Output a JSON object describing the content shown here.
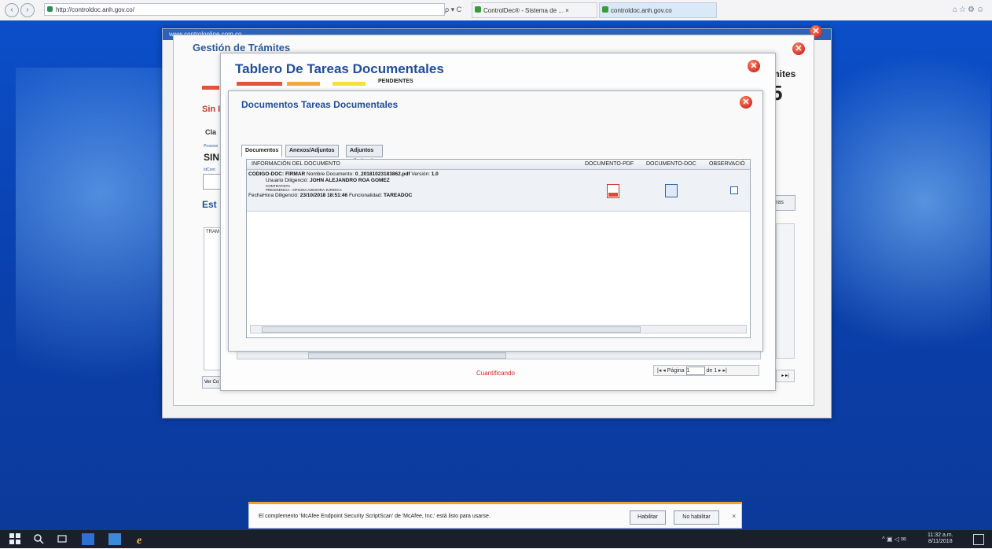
{
  "browser": {
    "address": "http://controldoc.anh.gov.co/",
    "address_controls": "ρ ▾ C",
    "tabs": [
      {
        "label": "ControlDec® - Sistema de ... ×"
      },
      {
        "label": "controldoc.anh.gov.co"
      }
    ],
    "nav_back": "‹",
    "nav_forward": "›",
    "toolbar_icons": "⌂☆⚙☺"
  },
  "portal": {
    "header": "www.controlonline.com.co"
  },
  "gestion": {
    "title": "Gestión de Trámites",
    "right_label": "mites",
    "right_number": "5",
    "left_fragments": [
      "Sin I",
      "Cla",
      "Proceso",
      "SIN",
      "IdCont",
      "Est",
      "TRAM",
      "Ver Co"
    ],
    "otros_button": "tras"
  },
  "tablero": {
    "title": "Tablero De Tareas Documentales",
    "pending_label": "PENDIENTES",
    "bar_colors": [
      "#e8523a",
      "#f0a93a",
      "#f2e23a"
    ],
    "status": "Cuantificando",
    "pager": {
      "first": "|◂",
      "prev": "◂",
      "page_label": "Página",
      "page_value": "1",
      "of_label": "de 1",
      "next": "▸",
      "last": "▸|"
    }
  },
  "documentos": {
    "title": "Documentos Tareas Documentales",
    "tabs": [
      "Documentos",
      "Anexos/Adjuntos",
      "Adjuntos Eliminados"
    ],
    "columns": [
      "INFORMACIÓN DEL DOCUMENTO",
      "DOCUMENTO-PDF",
      "DOCUMENTO-DOC",
      "OBSERVACIÓ"
    ],
    "row": {
      "codigo_label": "CODIGO-DOC:",
      "codigo_value": "FIRMAR",
      "nombre_label": "Nombre Documento:",
      "nombre_value": "0_20181023183862.pdf",
      "version_label": "Versión:",
      "version_value": "1.0",
      "usuario_label": "Usuario Diligenció:",
      "usuario_value": "JOHN ALEJANDRO ROA GOMEZ",
      "cargo": "CONTRATISTA",
      "dependencia": "PRESIDENCIA - OFICINA ASESORA JURIDICA",
      "fecha_label": "FechaHora Diligenció:",
      "fecha_value": "23/10/2018 18:51:46",
      "funcionalidad_label": "Funcionalidad:",
      "funcionalidad_value": "TAREADOC"
    }
  },
  "notification": {
    "text": "El complemento 'McAfee Endpoint Security ScriptScan' de 'McAfee, Inc.' está listo para usarse.",
    "enable": "Habilitar",
    "disable": "No habilitar",
    "close": "×"
  },
  "taskbar": {
    "tray": "^ ▣ ◁ ✉",
    "time": "11:32 a.m.",
    "date": "8/11/2018"
  }
}
